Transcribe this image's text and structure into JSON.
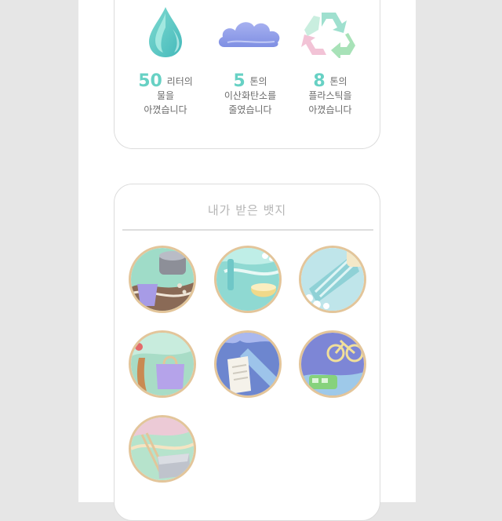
{
  "savings": [
    {
      "number": "50",
      "unit": "리터의",
      "line2": "물을",
      "line3": "아꼈습니다",
      "icon": "water-drop-icon"
    },
    {
      "number": "5",
      "unit": "톤의",
      "line2": "이산화탄소를",
      "line3": "줄였습니다",
      "icon": "cloud-icon"
    },
    {
      "number": "8",
      "unit": "톤의",
      "line2": "플라스틱을",
      "line3": "아꼈습니다",
      "icon": "recycle-icon"
    }
  ],
  "badges_section": {
    "title": "내가 받은 뱃지",
    "badges": [
      {
        "icon": "coffee-cup-badge-icon"
      },
      {
        "icon": "toothbrush-soap-badge-icon"
      },
      {
        "icon": "shower-badge-icon"
      },
      {
        "icon": "shopping-bag-badge-icon"
      },
      {
        "icon": "paper-badge-icon"
      },
      {
        "icon": "bicycle-bus-badge-icon"
      },
      {
        "icon": "lunchbox-chopsticks-badge-icon"
      }
    ]
  },
  "colors": {
    "accent": "#67d1c4",
    "badge_border": "#e3c59a",
    "card_border": "#dcdcdc"
  }
}
